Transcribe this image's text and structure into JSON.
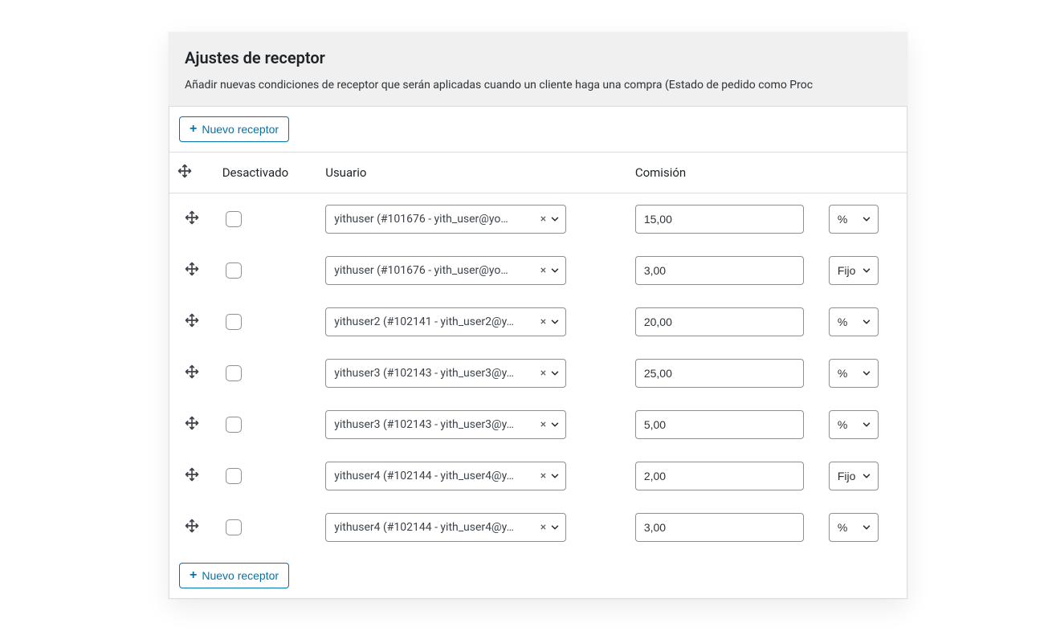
{
  "header": {
    "title": "Ajustes de receptor",
    "description": "Añadir nuevas condiciones de receptor que serán aplicadas cuando un cliente haga una compra (Estado de pedido como Proc"
  },
  "actions": {
    "new_receiver_label": "Nuevo receptor"
  },
  "columns": {
    "disabled": "Desactivado",
    "user": "Usuario",
    "commission": "Comisión"
  },
  "type_options": {
    "percent": "%",
    "fixed": "Fijo"
  },
  "rows": [
    {
      "user": "yithuser (#101676 - yith_user@yo…",
      "commission": "15,00",
      "type": "%"
    },
    {
      "user": "yithuser (#101676 - yith_user@yo…",
      "commission": "3,00",
      "type": "Fijo"
    },
    {
      "user": "yithuser2 (#102141 - yith_user2@y…",
      "commission": "20,00",
      "type": "%"
    },
    {
      "user": "yithuser3 (#102143 - yith_user3@y…",
      "commission": "25,00",
      "type": "%"
    },
    {
      "user": "yithuser3 (#102143 - yith_user3@y…",
      "commission": "5,00",
      "type": "%"
    },
    {
      "user": "yithuser4 (#102144 - yith_user4@y…",
      "commission": "2,00",
      "type": "Fijo"
    },
    {
      "user": "yithuser4 (#102144 - yith_user4@y…",
      "commission": "3,00",
      "type": "%"
    }
  ]
}
